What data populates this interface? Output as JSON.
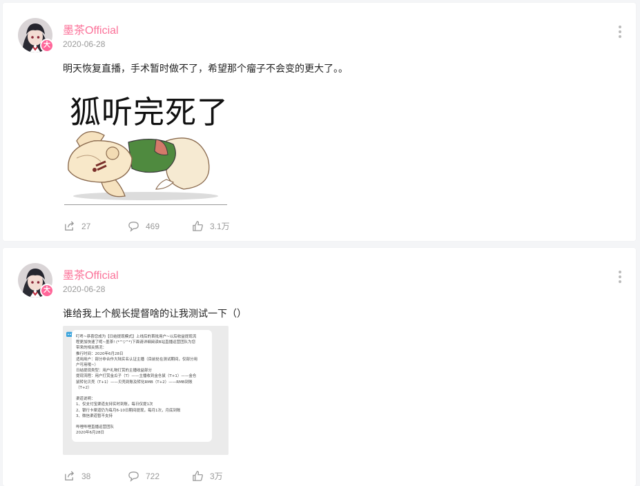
{
  "colors": {
    "accent": "#fb7299",
    "badge": "#ff6699",
    "muted": "#999999"
  },
  "posts": [
    {
      "user": {
        "name": "墨茶Official",
        "badge_glyph": "大"
      },
      "date": "2020-06-28",
      "text": "明天恢复直播，手术暂时做不了，希望那个瘤子不会变的更大了。。",
      "image": {
        "kind": "meme",
        "caption": "狐听完死了"
      },
      "stats": {
        "share": "27",
        "comment": "469",
        "like": "3.1万"
      }
    },
    {
      "user": {
        "name": "墨茶Official",
        "badge_glyph": "大"
      },
      "date": "2020-06-28",
      "text": "谁给我上个舰长提督啥的让我测试一下（）",
      "image": {
        "kind": "screenshot",
        "lines": [
          "叮咚~恭喜您成为【日结提现模式】上线后的首批用户~以后收益提现流",
          "程更加快速了呢~墨茶! (*^▽^*)下面请详细阅读B站直播运营团队为您",
          "带来的相关情况：",
          "推行时间：2020年6月28日",
          "适用用户：部分非合作大陆实名认证主播（目前处在测试期间，仅部分用",
          "户可用哦~）",
          "日结提现类型：用户礼物打赏的主播收益部分",
          "提现流程：用户打赏金瓜子（T）——主播收到金仓鼠（T+1）——金仓",
          "鼠转化贝壳（T+1）——贝壳到账及转化RMB（T+2）——RMB到账",
          "（T+2）",
          "",
          "渠道说明：",
          "1、仅支付宝渠道支持实时到账，每日仅提1次",
          "2、银行卡渠道仍为每月6-10日期间提现，每月1次，月底到账",
          "3、微信渠道暂不支持",
          "",
          "哔哩哔哩直播运营团队",
          "2020年6月28日"
        ]
      },
      "stats": {
        "share": "38",
        "comment": "722",
        "like": "3万"
      }
    }
  ]
}
